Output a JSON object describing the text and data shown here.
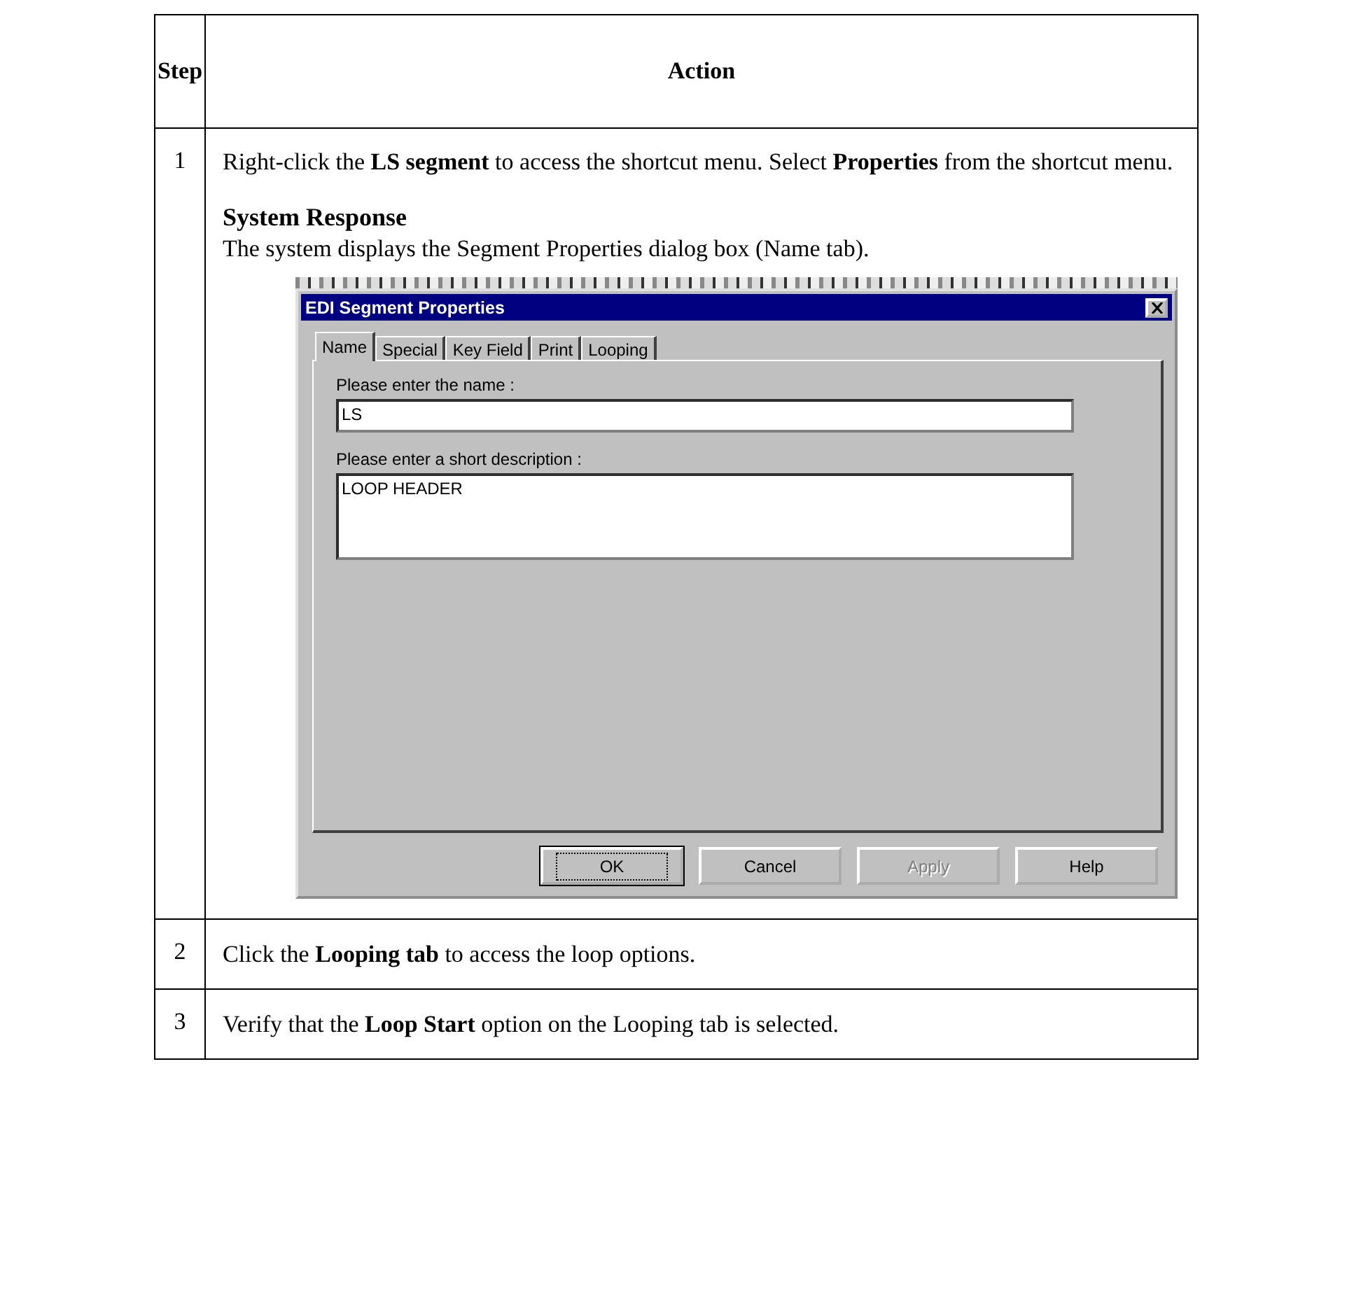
{
  "table": {
    "columns": [
      "Step",
      "Action"
    ],
    "rows": [
      {
        "step": "1",
        "instruction": "Right-click the **LS segment** to access the shortcut menu. Select **Properties** from the shortcut menu.",
        "response_heading": "System Response",
        "response_text": "The system displays the Segment Properties dialog box (Name tab).",
        "dialog": {
          "title": "EDI Segment Properties",
          "tabs": [
            {
              "label": "Name",
              "selected": true
            },
            {
              "label": "Special",
              "selected": false
            },
            {
              "label": "Key Field",
              "selected": false
            },
            {
              "label": "Print",
              "selected": false
            },
            {
              "label": "Looping",
              "selected": false
            }
          ],
          "fields": [
            {
              "kind": "single",
              "label": "Please enter the name :",
              "value": "LS"
            },
            {
              "kind": "multi",
              "label": "Please enter a short description :",
              "value": "LOOP HEADER"
            }
          ],
          "buttons": [
            {
              "label": "OK",
              "disabled": false,
              "focused": true
            },
            {
              "label": "Cancel",
              "disabled": false,
              "focused": false
            },
            {
              "label": "Apply",
              "disabled": true,
              "focused": false
            },
            {
              "label": "Help",
              "disabled": false,
              "focused": false
            }
          ]
        }
      },
      {
        "step": "2",
        "instruction": "Click the **Looping tab** to access the loop options."
      },
      {
        "step": "3",
        "instruction": "Verify that the **Loop Start** option on the Looping tab is selected."
      }
    ]
  }
}
